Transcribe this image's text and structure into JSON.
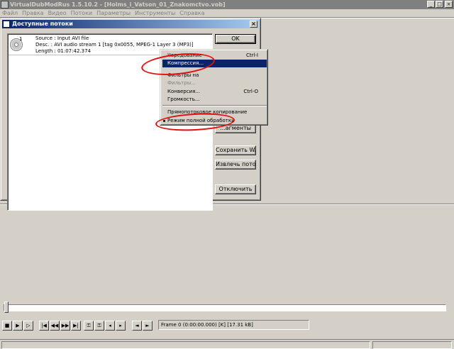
{
  "window": {
    "title": "VirtualDubModRus 1.5.10.2 - [Holms_i_Vatson_01_Znakomctvo.vob]",
    "minimize_glyph": "_",
    "maximize_glyph": "□",
    "close_glyph": "×"
  },
  "menubar": {
    "items": [
      {
        "label": "Файл"
      },
      {
        "label": "Правка"
      },
      {
        "label": "Видео"
      },
      {
        "label": "Потоки"
      },
      {
        "label": "Параметры"
      },
      {
        "label": "Инструменты"
      },
      {
        "label": "Справка"
      }
    ]
  },
  "dialog": {
    "title": "Доступные потоки",
    "close_glyph": "×",
    "stream": {
      "number": "1",
      "source": "Source : Input AVI file",
      "desc": "Desc. : AVI audio stream 1 [tag 0x0055, MPEG-1 Layer 3 (MP3)]",
      "length": "Length : 01:07:42.374"
    },
    "buttons": {
      "ok": "OK",
      "fragments": "...агменты",
      "save_wav": "Сохранить WAV",
      "extract": "Извлечь поток",
      "disable": "Отключить"
    }
  },
  "context_menu": {
    "items": [
      {
        "label": "Чередование",
        "shortcut": "Ctrl-I",
        "disabled": false
      },
      {
        "label": "Компрессия...",
        "shortcut": "",
        "disabled": false,
        "selected": true
      },
      {
        "label": "Фильтры на",
        "shortcut": "",
        "disabled": false
      },
      {
        "label": "Фильтры...",
        "shortcut": "",
        "disabled": true
      },
      {
        "label": "Конверсия...",
        "shortcut": "Ctrl-O",
        "disabled": false
      },
      {
        "label": "Громкость...",
        "shortcut": "",
        "disabled": false
      },
      {
        "label": "Прямопотоковое копирование",
        "shortcut": "",
        "disabled": false
      },
      {
        "label": "Режим полной обработки",
        "shortcut": "",
        "disabled": false,
        "checked": true
      }
    ]
  },
  "toolbar": {
    "status_text": "Frame 0 (0:00:00.000) [K] [17.31 kB]"
  },
  "colors": {
    "annotation": "#e01010",
    "selection": "#0a246a"
  }
}
